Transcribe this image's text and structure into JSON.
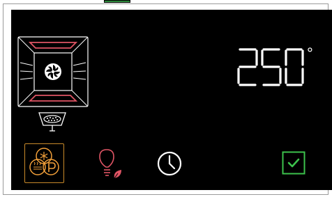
{
  "temperature": {
    "value": "250",
    "unit": "°"
  },
  "icons": {
    "oven": "oven-fan-heating-icon",
    "tray": "baking-tray-icon",
    "modes": "cooking-modes-icon",
    "light": "oven-light-eco-icon",
    "timer": "clock-icon",
    "confirm": "checkbox-confirm-icon"
  },
  "colors": {
    "background": "#000000",
    "heating_element": "#e05565",
    "modes_accent": "#f2a03a",
    "light_accent": "#e05565",
    "confirm_accent": "#3cc24c",
    "text": "#ffffff"
  }
}
